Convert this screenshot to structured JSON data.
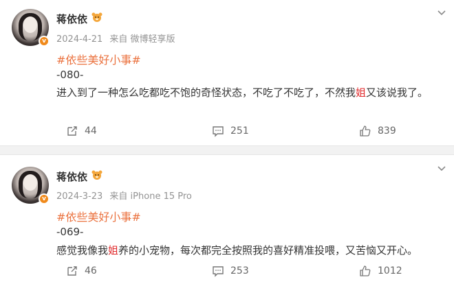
{
  "posts": [
    {
      "username": "蒋依依",
      "crown_icon": "crown-bear-icon",
      "verified_icon": "v-badge-icon",
      "date": "2024-4-21",
      "source": "来自 微博轻享版",
      "topic": "#依些美好小事#",
      "number": "-080-",
      "body_pre": "进入到了一种怎么吃都吃不饱的奇怪状态，不吃了不吃了，不然我",
      "body_highlight": "姐",
      "body_post": "又该说我了。",
      "reposts": "44",
      "comments": "251",
      "likes": "839"
    },
    {
      "username": "蒋依依",
      "crown_icon": "crown-bear-icon",
      "verified_icon": "v-badge-icon",
      "date": "2024-3-23",
      "source": "来自 iPhone 15 Pro",
      "topic": "#依些美好小事#",
      "number": "-069-",
      "body_pre": "感觉我像我",
      "body_highlight": "姐",
      "body_post": "养的小宠物，每次都完全按照我的喜好精准投喂，又苦恼又开心。",
      "reposts": "46",
      "comments": "253",
      "likes": "1012"
    }
  ],
  "colors": {
    "topic": "#eb7340",
    "highlight": "#e0292b",
    "meta": "#939393",
    "badge": "#f08a1c"
  }
}
